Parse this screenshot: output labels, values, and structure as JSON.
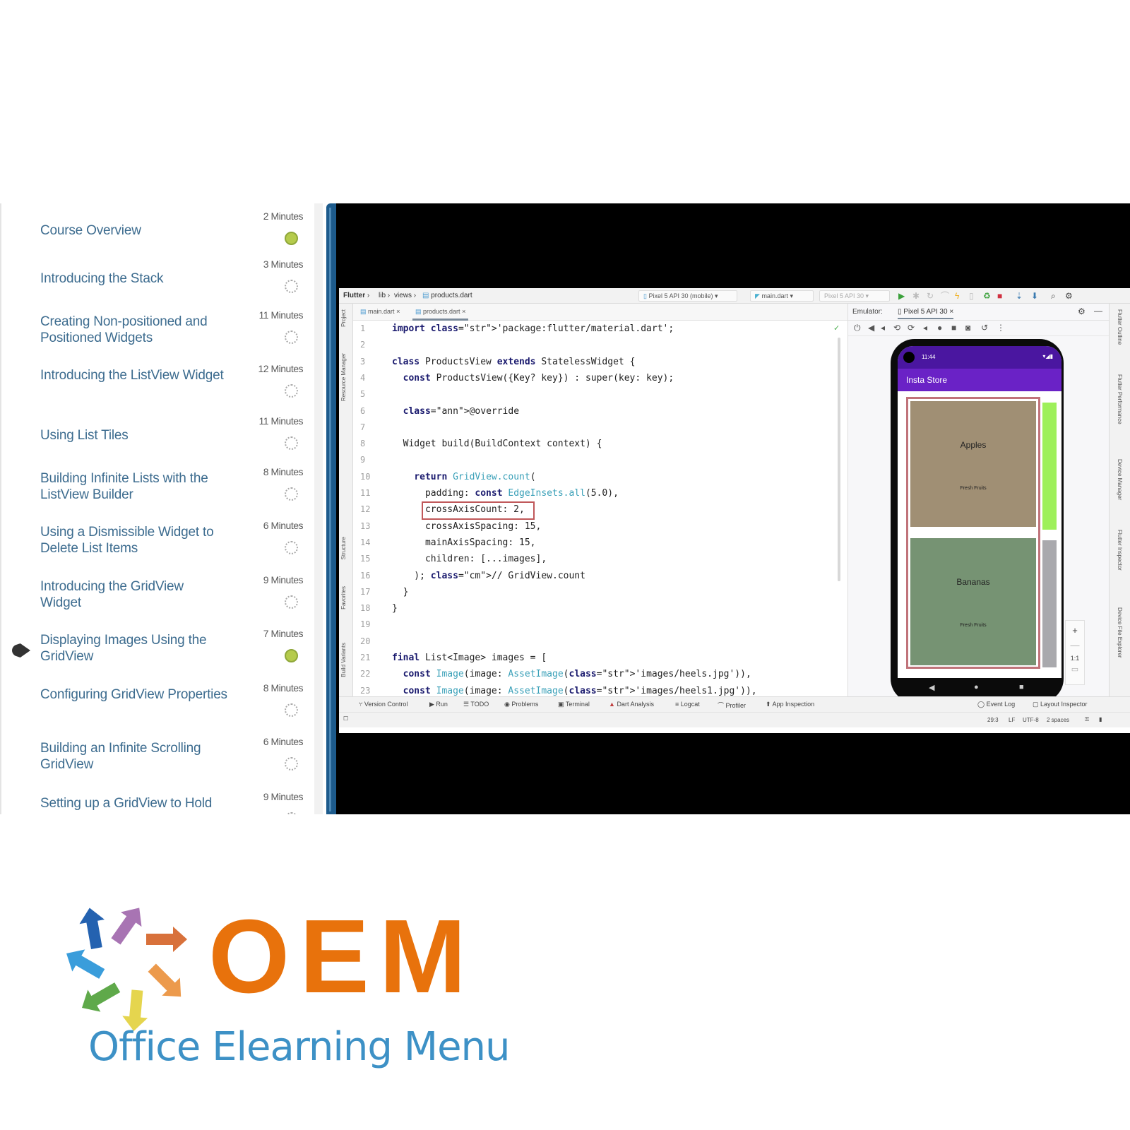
{
  "course": {
    "lessons": [
      {
        "title": "Course Overview",
        "duration": "2 Minutes",
        "status": "completed"
      },
      {
        "title": "Introducing the Stack",
        "duration": "3 Minutes",
        "status": "not-started"
      },
      {
        "title": "Creating Non-positioned and Positioned Widgets",
        "duration": "11 Minutes",
        "status": "not-started"
      },
      {
        "title": "Introducing the ListView Widget",
        "duration": "12 Minutes",
        "status": "not-started"
      },
      {
        "title": "Using List Tiles",
        "duration": "11 Minutes",
        "status": "not-started"
      },
      {
        "title": "Building Infinite Lists with the ListView Builder",
        "duration": "8 Minutes",
        "status": "not-started"
      },
      {
        "title": "Using a Dismissible Widget to Delete List Items",
        "duration": "6 Minutes",
        "status": "not-started"
      },
      {
        "title": "Introducing the GridView Widget",
        "duration": "9 Minutes",
        "status": "not-started"
      },
      {
        "title": "Displaying Images Using the GridView",
        "duration": "7 Minutes",
        "status": "completed",
        "current": true
      },
      {
        "title": "Configuring GridView Properties",
        "duration": "8 Minutes",
        "status": "not-started"
      },
      {
        "title": "Building an Infinite Scrolling GridView",
        "duration": "6 Minutes",
        "status": "not-started"
      },
      {
        "title": "Setting up a GridView to Hold",
        "duration": "9 Minutes",
        "status": "not-started"
      }
    ]
  },
  "ide": {
    "breadcrumb": [
      "Flutter",
      "lib",
      "views",
      "products.dart"
    ],
    "device_selector": "Pixel 5 API 30 (mobile)",
    "run_config": "main.dart",
    "device_selector_2": "Pixel 5 API 30",
    "tabs": [
      {
        "label": "main.dart",
        "active": false
      },
      {
        "label": "products.dart",
        "active": true
      }
    ],
    "left_tool_windows": [
      "Project",
      "Resource Manager",
      "Structure",
      "Favorites",
      "Build Variants"
    ],
    "right_tool_windows": [
      "Flutter Outline",
      "Flutter Performance",
      "Device Manager",
      "Flutter Inspector",
      "Device File Explorer"
    ],
    "code_lines": [
      {
        "n": "1",
        "text": "import 'package:flutter/material.dart';"
      },
      {
        "n": "2",
        "text": ""
      },
      {
        "n": "3",
        "text": "class ProductsView extends StatelessWidget {"
      },
      {
        "n": "4",
        "text": "  const ProductsView({Key? key}) : super(key: key);"
      },
      {
        "n": "5",
        "text": ""
      },
      {
        "n": "6",
        "text": "  @override"
      },
      {
        "n": "7",
        "text": ""
      },
      {
        "n": "8",
        "text": "  Widget build(BuildContext context) {"
      },
      {
        "n": "9",
        "text": ""
      },
      {
        "n": "10",
        "text": "    return GridView.count("
      },
      {
        "n": "11",
        "text": "      padding: const EdgeInsets.all(5.0),"
      },
      {
        "n": "12",
        "text": "      crossAxisCount: 2,"
      },
      {
        "n": "13",
        "text": "      crossAxisSpacing: 15,"
      },
      {
        "n": "14",
        "text": "      mainAxisSpacing: 15,"
      },
      {
        "n": "15",
        "text": "      children: [...images],"
      },
      {
        "n": "16",
        "text": "    ); // GridView.count"
      },
      {
        "n": "17",
        "text": "  }"
      },
      {
        "n": "18",
        "text": "}"
      },
      {
        "n": "19",
        "text": ""
      },
      {
        "n": "20",
        "text": ""
      },
      {
        "n": "21",
        "text": "final List<Image> images = ["
      },
      {
        "n": "22",
        "text": "  const Image(image: AssetImage('images/heels.jpg')),"
      },
      {
        "n": "23",
        "text": "  const Image(image: AssetImage('images/heels1.jpg')),"
      }
    ],
    "highlighted_line": "12",
    "emulator": {
      "label": "Emulator:",
      "device_tab": "Pixel 5 API 30",
      "phone_time": "11:44",
      "app_title": "Insta Store",
      "tiles": [
        {
          "name": "Apples",
          "subtitle": "Fresh Fruits",
          "color": "#a08f74"
        },
        {
          "name": "Bananas",
          "subtitle": "Fresh Fruits",
          "color": "#769373"
        }
      ],
      "side_tiles_colors": [
        "#9ef05a",
        "#a9a9ad"
      ],
      "zoom_level": "1:1"
    },
    "bottom_tools": [
      "Version Control",
      "Run",
      "TODO",
      "Problems",
      "Terminal",
      "Dart Analysis",
      "Logcat",
      "Profiler",
      "App Inspection"
    ],
    "bottom_right_tools": [
      "Event Log",
      "Layout Inspector"
    ],
    "status": {
      "position": "29:3",
      "line_sep": "LF",
      "encoding": "UTF-8",
      "indent": "2 spaces"
    }
  },
  "logo": {
    "wordmark": "OEM",
    "tagline": "Office Elearning Menu",
    "colors": {
      "wordmark": "#e8720c",
      "tagline": "#3d91c6"
    }
  }
}
